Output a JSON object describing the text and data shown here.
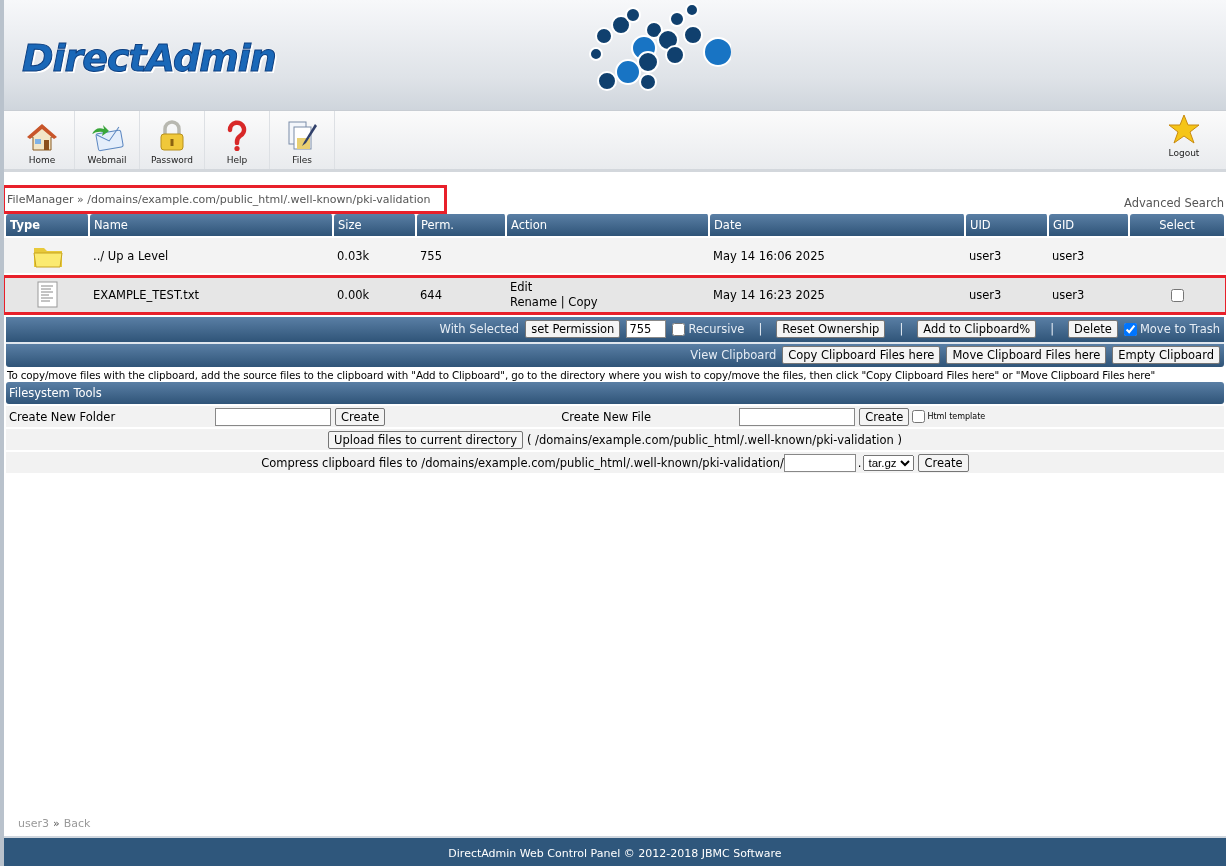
{
  "header": {
    "logo": "DirectAdmin"
  },
  "toolbar": {
    "items": [
      {
        "kind": "home",
        "label": "Home"
      },
      {
        "kind": "webmail",
        "label": "Webmail"
      },
      {
        "kind": "password",
        "label": "Password"
      },
      {
        "kind": "help",
        "label": "Help"
      },
      {
        "kind": "files",
        "label": "Files"
      }
    ],
    "logout": {
      "kind": "logout",
      "label": "Logout"
    }
  },
  "breadcrumb": {
    "text": "FileManager » /domains/example.com/public_html/.well-known/pki-validation",
    "highlighted": true
  },
  "advanced_search": "Advanced Search",
  "table": {
    "columns": [
      "Type",
      "Name",
      "Size",
      "Perm.",
      "Action",
      "Date",
      "UID",
      "GID",
      "Select"
    ],
    "rows": [
      {
        "kind": "folder",
        "name": "../ Up a Level",
        "size": "0.03k",
        "perm": "755",
        "actions": [],
        "date": "May 14 16:06 2025",
        "uid": "user3",
        "gid": "user3",
        "highlighted": false
      },
      {
        "kind": "file",
        "name": "EXAMPLE_TEST.txt",
        "size": "0.00k",
        "perm": "644",
        "actions": [
          [
            "Edit"
          ],
          [
            "Rename",
            "Copy"
          ]
        ],
        "action_separator": "|",
        "date": "May 14 16:23 2025",
        "uid": "user3",
        "gid": "user3",
        "checked": false,
        "highlighted": true
      }
    ]
  },
  "with_selected": [
    {
      "kind": "label",
      "text": "With Selected"
    },
    {
      "kind": "button",
      "text": "set Permission"
    },
    {
      "kind": "input",
      "value": "755"
    },
    {
      "kind": "checkbox",
      "text": "Recursive",
      "checked": false
    },
    {
      "kind": "sep",
      "text": "|"
    },
    {
      "kind": "button",
      "text": "Reset Ownership"
    },
    {
      "kind": "sep",
      "text": "|"
    },
    {
      "kind": "button",
      "text": "Add to Clipboard%"
    },
    {
      "kind": "sep",
      "text": "|"
    },
    {
      "kind": "button",
      "text": "Delete"
    },
    {
      "kind": "checkbox",
      "text": "Move to Trash",
      "checked": true
    }
  ],
  "clipboard_bar": [
    {
      "kind": "label",
      "text": "View Clipboard"
    },
    {
      "kind": "button",
      "text": "Copy Clipboard Files here"
    },
    {
      "kind": "button",
      "text": "Move Clipboard Files here"
    },
    {
      "kind": "button",
      "text": "Empty Clipboard"
    }
  ],
  "clipboard_help": "To copy/move files with the clipboard, add the source files to the clipboard with \"Add to Clipboard\", go to the directory where you wish to copy/move the files, then click \"Copy Clipboard Files here\" or \"Move Clipboard Files here\"",
  "tools": {
    "title": "Filesystem Tools",
    "create_folder": {
      "label": "Create New Folder",
      "button": "Create"
    },
    "create_file": {
      "label": "Create New File",
      "button": "Create",
      "template": {
        "label": "Html template",
        "checked": false
      }
    },
    "upload": {
      "button": "Upload files to current directory",
      "path": "( /domains/example.com/public_html/.well-known/pki-validation )"
    },
    "compress": {
      "label": "Compress clipboard files to /domains/example.com/public_html/.well-known/pki-validation/",
      "dot": ".",
      "format": "tar.gz",
      "button": "Create"
    }
  },
  "nav": {
    "user": "user3",
    "sep": "»",
    "back": "Back"
  },
  "footer": "DirectAdmin Web Control Panel © 2012-2018 JBMC Software"
}
